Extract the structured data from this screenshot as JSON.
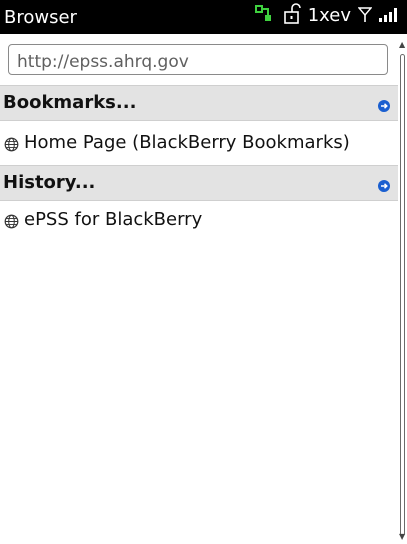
{
  "status_bar": {
    "app_title": "Browser",
    "network": "1xev"
  },
  "address_bar": {
    "value": "http://epss.ahrq.gov"
  },
  "bookmarks": {
    "header": "Bookmarks...",
    "items": [
      {
        "label": "Home Page (BlackBerry Bookmarks)"
      }
    ]
  },
  "history": {
    "header": "History...",
    "items": [
      {
        "label": "ePSS for BlackBerry"
      }
    ]
  },
  "colors": {
    "status_bg": "#000000",
    "section_bg": "#e3e3e3",
    "accent_blue": "#1a5fd0",
    "signal_green": "#2fbf2f"
  }
}
